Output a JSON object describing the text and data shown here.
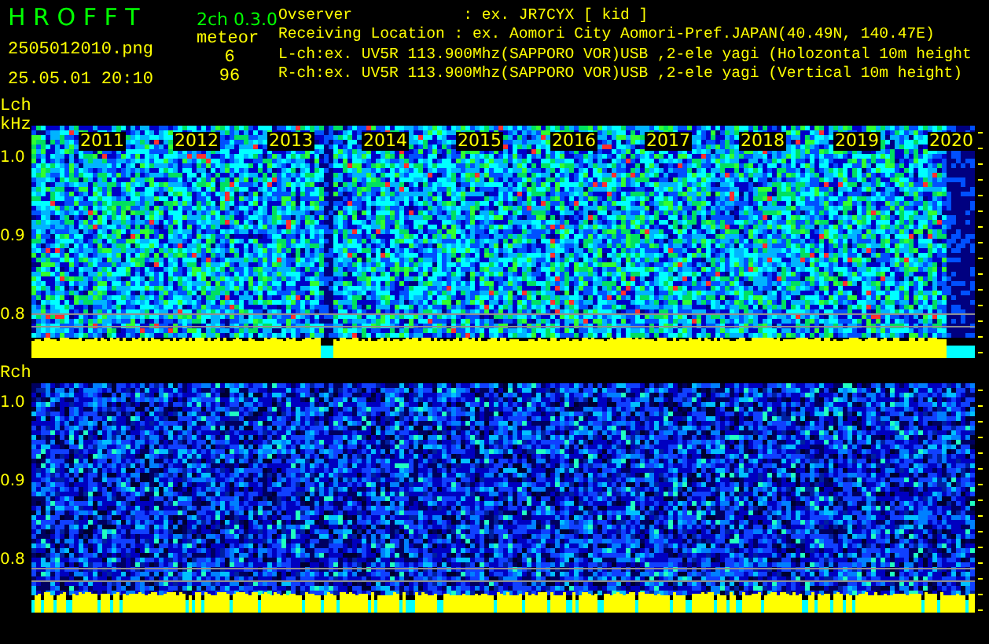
{
  "header": {
    "app_title": "H R O F F T",
    "version": "2ch 0.3.0",
    "mode": "meteor",
    "filename": "2505012010.png",
    "datetime": "25.05.01 20:10",
    "l_count": "6",
    "r_count": "96",
    "info_lines": [
      "Ovserver            : ex. JR7CYX [ kid ]",
      "Receiving Location : ex. Aomori City Aomori-Pref.JAPAN(40.49N, 140.47E)",
      "L-ch:ex. UV5R 113.900Mhz(SAPPORO VOR)USB ,2-ele yagi (Holozontal 10m height",
      "R-ch:ex. UV5R 113.900Mhz(SAPPORO VOR)USB ,2-ele yagi (Vertical 10m height)"
    ]
  },
  "panels": [
    {
      "label": "Lch",
      "unit": "kHz",
      "years": [
        "2011",
        "2012",
        "2013",
        "2014",
        "2015",
        "2016",
        "2017",
        "2018",
        "2019",
        "2020"
      ],
      "yticks": [
        "1.0",
        "0.9",
        "0.8"
      ]
    },
    {
      "label": "Rch",
      "yticks": [
        "1.0",
        "0.9",
        "0.8"
      ]
    }
  ]
}
